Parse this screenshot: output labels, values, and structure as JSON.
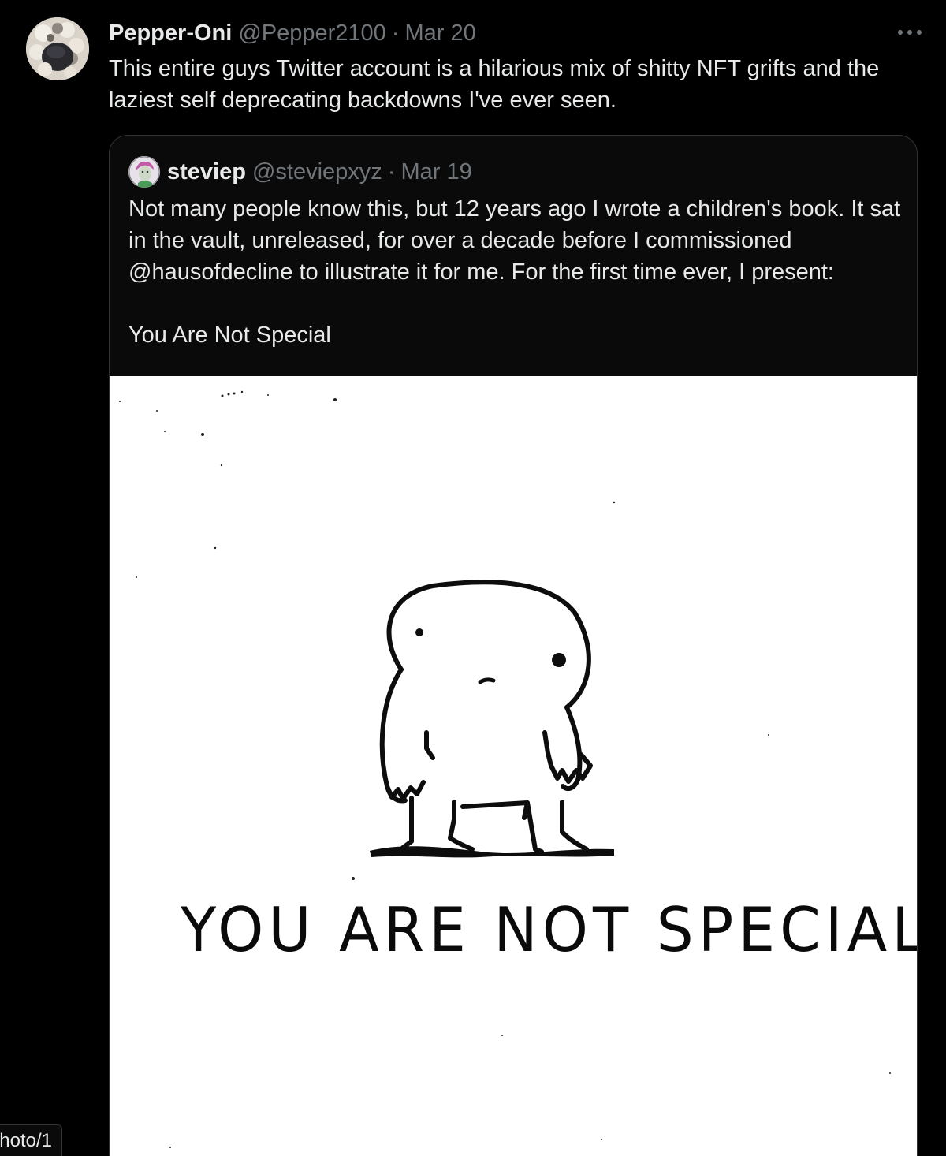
{
  "tweet": {
    "author": {
      "display_name": "Pepper-Oni",
      "handle": "@Pepper2100",
      "separator": "·",
      "time": "Mar 20"
    },
    "more_icon": "ellipsis-icon",
    "text": "This entire guys Twitter account is a hilarious mix of shitty NFT grifts and the laziest self deprecating backdowns I've ever seen.",
    "quoted": {
      "author": {
        "display_name": "steviep",
        "handle": "@steviepxyz",
        "separator": "·",
        "time": "Mar 19"
      },
      "text_paragraph_1": "Not many people know this, but 12 years ago I wrote a children's book. It sat in the vault, unreleased, for over a decade before I commissioned @hausofdecline to illustrate it for me. For the first time ever, I present:",
      "text_paragraph_2": "You Are Not Special",
      "media": {
        "caption": "YOU ARE NOT SPECIAL."
      }
    }
  },
  "status_bar": {
    "url_fragment": "hoto/1"
  },
  "colors": {
    "background": "#000000",
    "text_primary": "#e7e9ea",
    "text_secondary": "#71767b",
    "border": "#2f3336"
  }
}
